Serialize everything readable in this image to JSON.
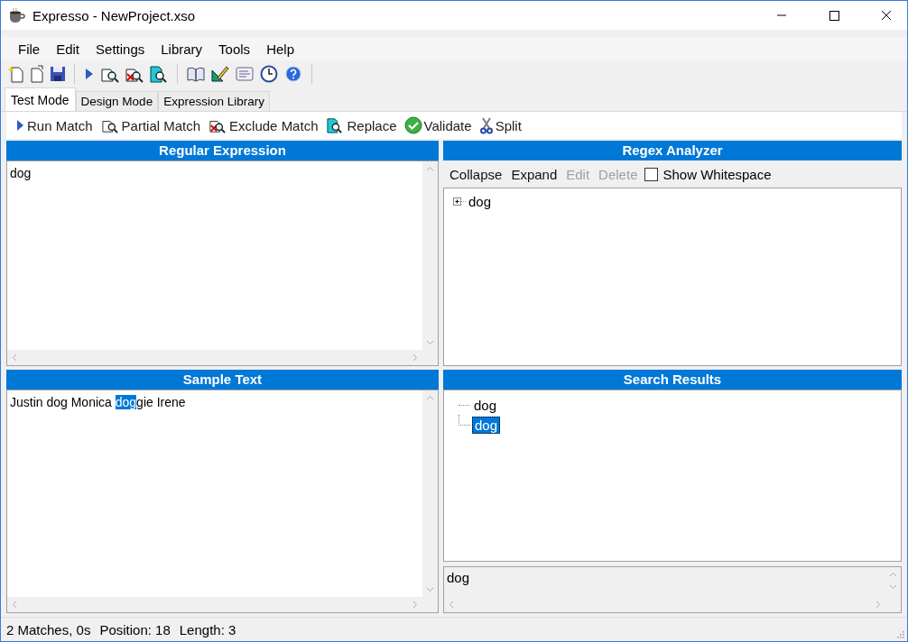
{
  "window": {
    "title": "Expresso - NewProject.xso"
  },
  "menu": [
    "File",
    "Edit",
    "Settings",
    "Library",
    "Tools",
    "Help"
  ],
  "tabs": [
    {
      "label": "Test Mode",
      "selected": true
    },
    {
      "label": "Design Mode",
      "selected": false
    },
    {
      "label": "Expression Library",
      "selected": false
    }
  ],
  "actions": [
    {
      "label": "Run Match",
      "kind": "run"
    },
    {
      "label": "Partial Match",
      "kind": "partial"
    },
    {
      "label": "Exclude Match",
      "kind": "exclude"
    },
    {
      "label": "Replace",
      "kind": "replace"
    },
    {
      "label": "Validate",
      "kind": "validate"
    },
    {
      "label": "Split",
      "kind": "split"
    }
  ],
  "regex_panel": {
    "title": "Regular Expression",
    "value": "dog"
  },
  "analyzer": {
    "title": "Regex Analyzer",
    "commands": [
      {
        "label": "Collapse",
        "disabled": false
      },
      {
        "label": "Expand",
        "disabled": false
      },
      {
        "label": "Edit",
        "disabled": true
      },
      {
        "label": "Delete",
        "disabled": true
      }
    ],
    "show_whitespace": {
      "label": "Show Whitespace",
      "checked": false
    },
    "tree": [
      {
        "label": "dog",
        "expanded": false
      }
    ]
  },
  "sample": {
    "title": "Sample Text",
    "before": "Justin dog Monica ",
    "selection": "dog",
    "after": "gie Irene"
  },
  "results": {
    "title": "Search Results",
    "items": [
      {
        "label": "dog",
        "selected": false
      },
      {
        "label": "dog",
        "selected": true
      }
    ],
    "detail": "dog"
  },
  "status_bar": [
    "2 Matches, 0s",
    "Position: 18",
    "Length: 3"
  ]
}
